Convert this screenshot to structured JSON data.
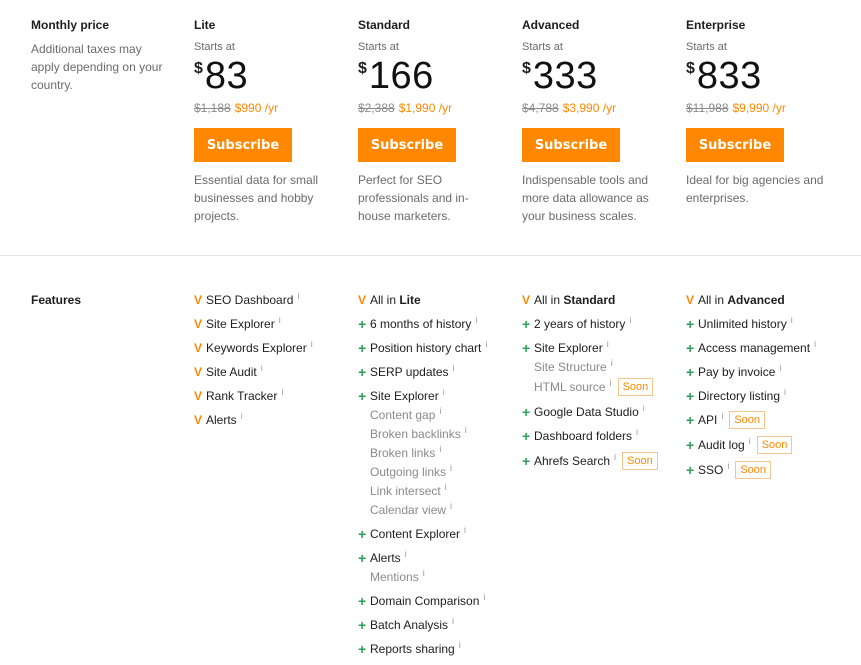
{
  "pricing": {
    "label": "Monthly price",
    "note": "Additional taxes may apply depending on your country.",
    "plans": [
      {
        "name": "Lite",
        "starts": "Starts at",
        "currency": "$",
        "price": "83",
        "old_annual": "$1,188",
        "new_annual": "$990 /yr",
        "cta": "Subscribe",
        "desc": "Essential data for small businesses and hobby projects."
      },
      {
        "name": "Standard",
        "starts": "Starts at",
        "currency": "$",
        "price": "166",
        "old_annual": "$2,388",
        "new_annual": "$1,990 /yr",
        "cta": "Subscribe",
        "desc": "Perfect for SEO professionals and in-house marketers."
      },
      {
        "name": "Advanced",
        "starts": "Starts at",
        "currency": "$",
        "price": "333",
        "old_annual": "$4,788",
        "new_annual": "$3,990 /yr",
        "cta": "Subscribe",
        "desc": "Indispensable tools and more data allowance as your business scales."
      },
      {
        "name": "Enterprise",
        "starts": "Starts at",
        "currency": "$",
        "price": "833",
        "old_annual": "$11,988",
        "new_annual": "$9,990 /yr",
        "cta": "Subscribe",
        "desc": "Ideal for big agencies and enterprises."
      }
    ]
  },
  "features": {
    "label": "Features",
    "info_glyph": "i",
    "soon_label": "Soon",
    "lite": [
      {
        "mark": "V",
        "text": "SEO Dashboard"
      },
      {
        "mark": "V",
        "text": "Site Explorer"
      },
      {
        "mark": "V",
        "text": "Keywords Explorer"
      },
      {
        "mark": "V",
        "text": "Site Audit"
      },
      {
        "mark": "V",
        "text": "Rank Tracker"
      },
      {
        "mark": "V",
        "text": "Alerts"
      }
    ],
    "standard": {
      "all_in_prefix": "All in ",
      "all_in_plan": "Lite",
      "items": [
        {
          "text": "6 months of history"
        },
        {
          "text": "Position history chart"
        },
        {
          "text": "SERP updates"
        },
        {
          "text": "Site Explorer",
          "subs": [
            "Content gap",
            "Broken backlinks",
            "Broken links",
            "Outgoing links",
            "Link intersect",
            "Calendar view"
          ]
        },
        {
          "text": "Content Explorer"
        },
        {
          "text": "Alerts",
          "subs": [
            "Mentions"
          ]
        },
        {
          "text": "Domain Comparison"
        },
        {
          "text": "Batch Analysis"
        },
        {
          "text": "Reports sharing"
        }
      ]
    },
    "advanced": {
      "all_in_prefix": "All in ",
      "all_in_plan": "Standard",
      "items": [
        {
          "text": "2 years of history"
        },
        {
          "text": "Site Explorer",
          "subs": [
            "Site Structure",
            "HTML source"
          ]
        },
        {
          "text": "Google Data Studio"
        },
        {
          "text": "Dashboard folders"
        },
        {
          "text": "Ahrefs Search"
        }
      ]
    },
    "enterprise": {
      "all_in_prefix": "All in ",
      "all_in_plan": "Advanced",
      "items": [
        {
          "text": "Unlimited history"
        },
        {
          "text": "Access management"
        },
        {
          "text": "Pay by invoice"
        },
        {
          "text": "Directory listing"
        },
        {
          "text": "API"
        },
        {
          "text": "Audit log"
        },
        {
          "text": "SSO"
        }
      ]
    }
  },
  "colors": {
    "accent": "#ff8800",
    "plus": "#2e9e5b",
    "muted": "#6b6b6b"
  }
}
